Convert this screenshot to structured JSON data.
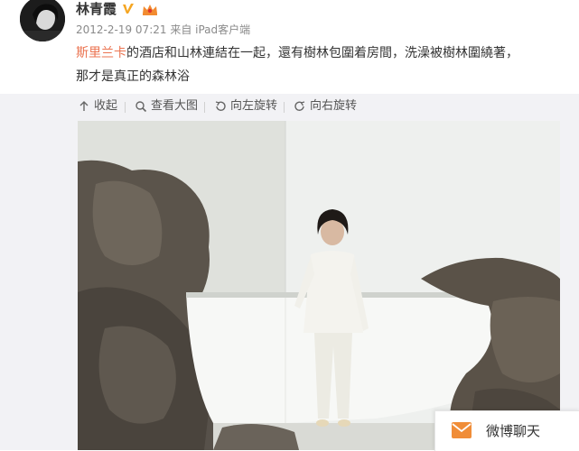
{
  "post": {
    "username": "林青霞",
    "timestamp": "2012-2-19 07:21",
    "source": "来自 iPad客户端",
    "topic": "斯里兰卡",
    "text_line1": "的酒店和山林連結在一起，還有樹林包圍着房間，洗澡被樹林圍繞著，",
    "text_line2": "那才是真正的森林浴"
  },
  "toolbar": {
    "collapse_label": "收起",
    "view_large_label": "查看大图",
    "rotate_left_label": "向左旋转",
    "rotate_right_label": "向右旋转"
  },
  "chat": {
    "label": "微博聊天"
  },
  "icons": {
    "verified": "verified-v-icon",
    "member": "vip-crown-icon",
    "collapse": "collapse-arrow-icon",
    "zoom": "magnifier-icon",
    "rotate_left": "rotate-left-icon",
    "rotate_right": "rotate-right-icon",
    "chat": "envelope-icon"
  },
  "colors": {
    "topic_link": "#eb7350",
    "verified": "#f5a623",
    "chat_icon": "#f08d38",
    "toolbar_bg": "#f2f2f5"
  }
}
